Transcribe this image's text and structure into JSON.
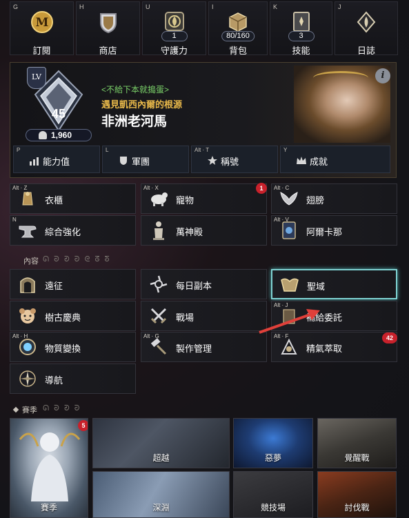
{
  "top_tabs": [
    {
      "key": "G",
      "label": "訂閱",
      "icon": "m-coin-icon",
      "badge": null
    },
    {
      "key": "H",
      "label": "商店",
      "icon": "shop-shield-icon",
      "badge": null
    },
    {
      "key": "U",
      "label": "守護力",
      "icon": "guardian-icon",
      "badge": "1"
    },
    {
      "key": "I",
      "label": "背包",
      "icon": "bag-box-icon",
      "badge": "80/160"
    },
    {
      "key": "K",
      "label": "技能",
      "icon": "skill-book-icon",
      "badge": "3"
    },
    {
      "key": "J",
      "label": "日誌",
      "icon": "journal-icon",
      "badge": null
    }
  ],
  "profile": {
    "lv_label": "LV",
    "level": "45",
    "combat_power": "1,960",
    "guild": "<不給下本就搗蛋>",
    "title": "遇見凱西內爾的根源",
    "name": "非洲老河馬",
    "info_label": "i"
  },
  "sub_tabs": [
    {
      "key": "P",
      "label": "能力值",
      "icon": "stats-bars-icon"
    },
    {
      "key": "L",
      "label": "軍團",
      "icon": "legion-shield-icon"
    },
    {
      "key": "Alt · T",
      "label": "稱號",
      "icon": "title-star-icon"
    },
    {
      "key": "Y",
      "label": "成就",
      "icon": "achievement-crown-icon"
    }
  ],
  "menu_group1": [
    {
      "key": "Alt · Z",
      "label": "衣櫃",
      "icon": "wardrobe-icon"
    },
    {
      "key": "Alt · X",
      "label": "寵物",
      "icon": "pet-icon",
      "badge": "1"
    },
    {
      "key": "Alt · C",
      "label": "翅膀",
      "icon": "wings-icon"
    },
    {
      "key": "N",
      "label": "綜合強化",
      "icon": "anvil-icon"
    },
    {
      "key": "",
      "label": "萬神殿",
      "icon": "pantheon-statue-icon"
    },
    {
      "key": "Alt · V",
      "label": "阿爾卡那",
      "icon": "arcana-card-icon"
    }
  ],
  "content_section": {
    "title": "內容",
    "glyphs": "ᘏ ᘐ ᘑ ᘒ ᘓ ᘔ ᘕ"
  },
  "menu_group2": [
    {
      "key": "",
      "label": "遠征",
      "icon": "expedition-gate-icon"
    },
    {
      "key": "",
      "label": "每日副本",
      "icon": "daily-dungeon-icon"
    },
    {
      "key": "",
      "label": "聖域",
      "icon": "sanctuary-icon"
    },
    {
      "key": "",
      "label": "樹古慶典",
      "icon": "festival-mascot-icon"
    },
    {
      "key": "",
      "label": "戰場",
      "icon": "crossed-swords-icon"
    },
    {
      "key": "Alt · J",
      "label": "補給委託",
      "icon": "supply-request-icon"
    },
    {
      "key": "Alt · H",
      "label": "物質變換",
      "icon": "transmute-orb-icon"
    },
    {
      "key": "Alt · G",
      "label": "製作管理",
      "icon": "craft-hammer-icon"
    },
    {
      "key": "Alt · F",
      "label": "精氣萃取",
      "icon": "essence-extract-icon",
      "badge": "42"
    },
    {
      "key": "",
      "label": "導航",
      "icon": "compass-icon"
    }
  ],
  "season_section": {
    "title": "賽季",
    "glyphs": "ᘏ ᘐ ᘑ ᘒ"
  },
  "season_tiles": [
    {
      "label": "賽季",
      "badge": "5"
    },
    {
      "label": "超越"
    },
    {
      "label": "惡夢"
    },
    {
      "label": "覺醒戰"
    },
    {
      "label": "深淵"
    },
    {
      "label": "競技場"
    },
    {
      "label": "討伐戰"
    }
  ],
  "colors": {
    "guild_green": "#7cd36a",
    "title_gold": "#e8b84a",
    "highlight_cyan": "#7fd3d3",
    "badge_red": "#c8212b"
  }
}
